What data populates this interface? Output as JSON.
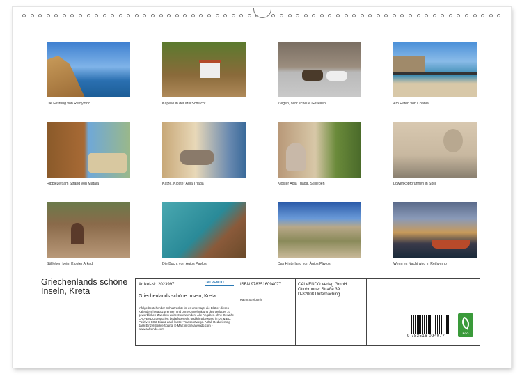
{
  "calendar": {
    "captions": [
      "Die Festung von Rethymno",
      "Kapelle in der Mili Schlucht",
      "Ziegen, sehr scheue Gesellen",
      "Am Hafen von Chania",
      "Hippiezeit am Strand von Matala",
      "Katze, Kloster Agia Triada",
      "Kloster Agia Triada, Stillleben",
      "Löwenkopfbrunnen in Spili",
      "Stillleben beim Kloster Arkadi",
      "Die Bucht von Àgios Pavlos",
      "Das Hinterland von Àgios Pàvlos",
      "Wenn es Nacht wird in Rethymno"
    ],
    "title": "Griechenlands schöne Inseln, Kreta",
    "article": "Artikel-Nr. 2023997",
    "logo": "CALVENDO",
    "subtitle": "Griechenlands schöne Inseln, Kreta",
    "legal": "Infolge bestehender Schutzrechte ist es untersagt, die Blätter dieses Kalenders herauszutrennen und ohne Genehmigung des Verlages zu gewerblichen Zwecken weiterzuverwenden. Alle Angaben ohne Gewähr. CALVENDO produziert bedarfsgerecht und klimabewusst in DE & EU. Positiver CO2-Bilanz dank kurzer Transportwege. Abfall-Reduzierung dank Einzelstückfertigung. E-Mail: info@calvendo.com • www.calvendo.com",
    "isbn": "ISBN 9783516094077",
    "author": "Katrin Streiparth",
    "publisher": [
      "CALVENDO Verlag GmbH",
      "Ottobrunner Straße 39",
      "D-82008 Unterhaching"
    ],
    "barcode_number": "9 783516 094077",
    "eco_label": "ECO"
  }
}
